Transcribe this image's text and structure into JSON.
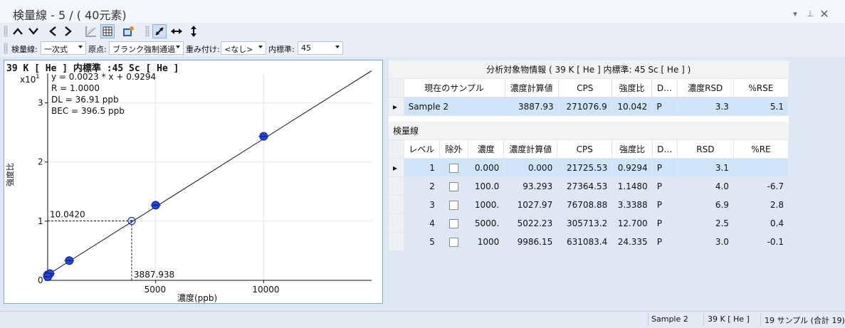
{
  "window": {
    "title": "検量線 - 5 / ( 40元素)"
  },
  "toolbar2": {
    "curve_label": "検量線:",
    "curve_value": "一次式",
    "origin_label": "原点:",
    "origin_value": "ブランク強制通過",
    "weight_label": "重み付け:",
    "weight_value": "<なし>",
    "istd_label": "内標準:",
    "istd_value": "45"
  },
  "chart": {
    "title": "39  K  [ He ]  内標準 :45  Sc  [ He ]",
    "multiplier": "x10",
    "multiplier_exp": "1",
    "equation": "y = 0.0023 * x  + 0.9294",
    "r": "R =  1.0000",
    "dl": "DL = 36.91 ppb",
    "bec": "BEC = 396.5 ppb",
    "ylabel": "強度比",
    "xlabel": "濃度(ppb)",
    "sample_ratio_label": "10.0420",
    "sample_conc_label": "3887.938"
  },
  "chart_data": {
    "type": "scatter",
    "xlabel": "濃度(ppb)",
    "ylabel": "強度比",
    "xlim": [
      0,
      10000
    ],
    "xlim_plot": [
      0,
      15000
    ],
    "ylim": [
      0,
      3.5
    ],
    "xticks": [
      "5000",
      "10000"
    ],
    "yticks": [
      "0",
      "1",
      "2",
      "3"
    ],
    "y_multiplier": "x10 1",
    "points_x": [
      0,
      100,
      1000,
      5000,
      10000,
      0
    ],
    "points_y": [
      0.09294,
      0.1148,
      0.33388,
      1.27,
      2.4335,
      0.06
    ],
    "fit_line": {
      "slope": 0.00023,
      "intercept": 0.09294
    },
    "sample": {
      "x": 3887.938,
      "y": 1.0042
    }
  },
  "analyte_table": {
    "caption": "分析対象物情報 ( 39  K  [ He ]  内標準: 45  Sc  [ He ] )",
    "headers": [
      "現在のサンプル",
      "濃度計算値",
      "CPS",
      "強度比",
      "D…",
      "濃度RSD",
      "%RSE"
    ],
    "row": [
      "Sample 2",
      "3887.93",
      "271076.9",
      "10.042",
      "P",
      "3.3",
      "5.1"
    ]
  },
  "curve_table": {
    "caption": "検量線",
    "headers": [
      "レベル",
      "除外",
      "濃度",
      "濃度計算値",
      "CPS",
      "強度比",
      "D…",
      "RSD",
      "%RE"
    ],
    "rows": [
      [
        "1",
        "",
        "0.000",
        "0.000",
        "21725.53",
        "0.9294",
        "P",
        "3.1",
        ""
      ],
      [
        "2",
        "",
        "100.0",
        "93.293",
        "27364.53",
        "1.1480",
        "P",
        "4.0",
        "-6.7"
      ],
      [
        "3",
        "",
        "1000.",
        "1027.97",
        "76708.88",
        "3.3388",
        "P",
        "6.9",
        "2.8"
      ],
      [
        "4",
        "",
        "5000.",
        "5022.23",
        "305713.2",
        "12.700",
        "P",
        "2.5",
        "0.4"
      ],
      [
        "5",
        "",
        "1000",
        "9986.15",
        "631083.4",
        "24.335",
        "P",
        "3.0",
        "-0.1"
      ]
    ]
  },
  "status": {
    "sample": "Sample 2",
    "element": "39  K  [ He ]",
    "count": "19 サンプル (合計 19)"
  }
}
